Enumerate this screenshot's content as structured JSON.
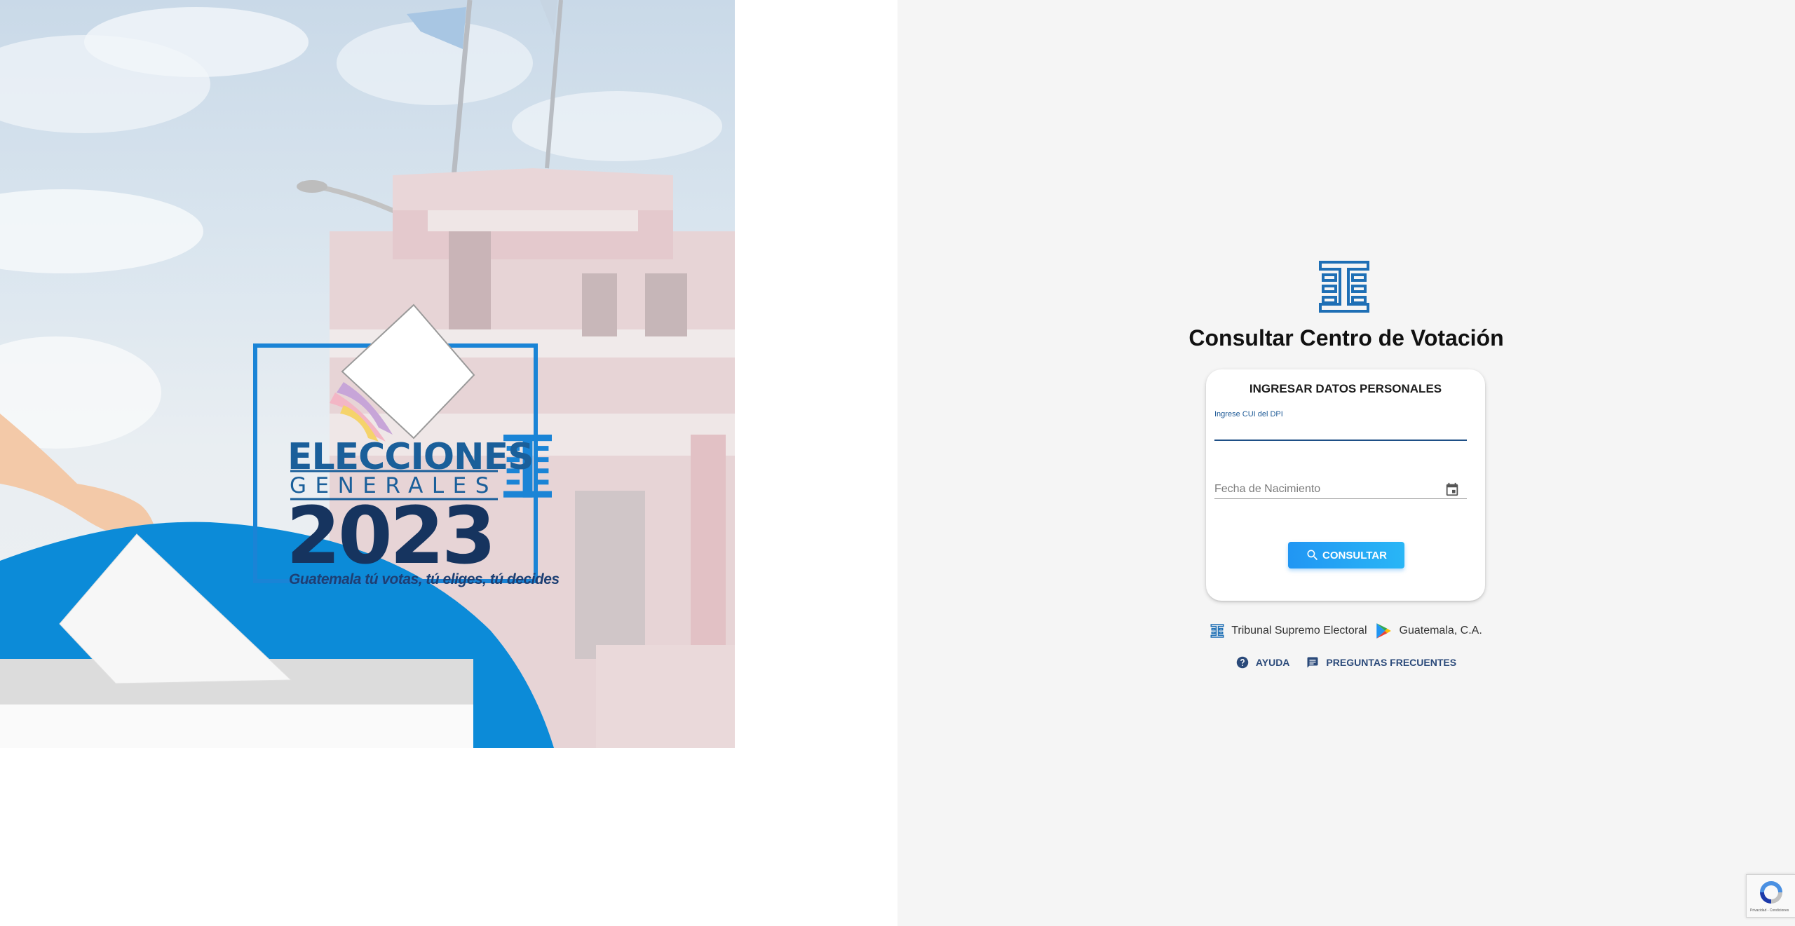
{
  "hero": {
    "wordmark_line1": "ELECCIONES",
    "wordmark_line2": "GENERALES",
    "year": "2023",
    "motto": "Guatemala tú votas, tú eliges, tú decides"
  },
  "page": {
    "title": "Consultar Centro de Votación"
  },
  "form": {
    "heading": "INGRESAR DATOS PERSONALES",
    "cui_label": "Ingrese CUI del DPI",
    "cui_value": "",
    "birthdate_placeholder": "Fecha de Nacimiento",
    "submit_label": "CONSULTAR"
  },
  "footer": {
    "organization": "Tribunal Supremo Electoral",
    "location": "Guatemala, C.A.",
    "help_label": "AYUDA",
    "faq_label": "PREGUNTAS FRECUENTES"
  },
  "recaptcha": {
    "text": "Privacidad - Condiciones"
  },
  "colors": {
    "primary_blue": "#2196f3",
    "brand_blue": "#1e6fb5",
    "dark_navy": "#16345f",
    "panel_bg": "#f5f5f5"
  }
}
